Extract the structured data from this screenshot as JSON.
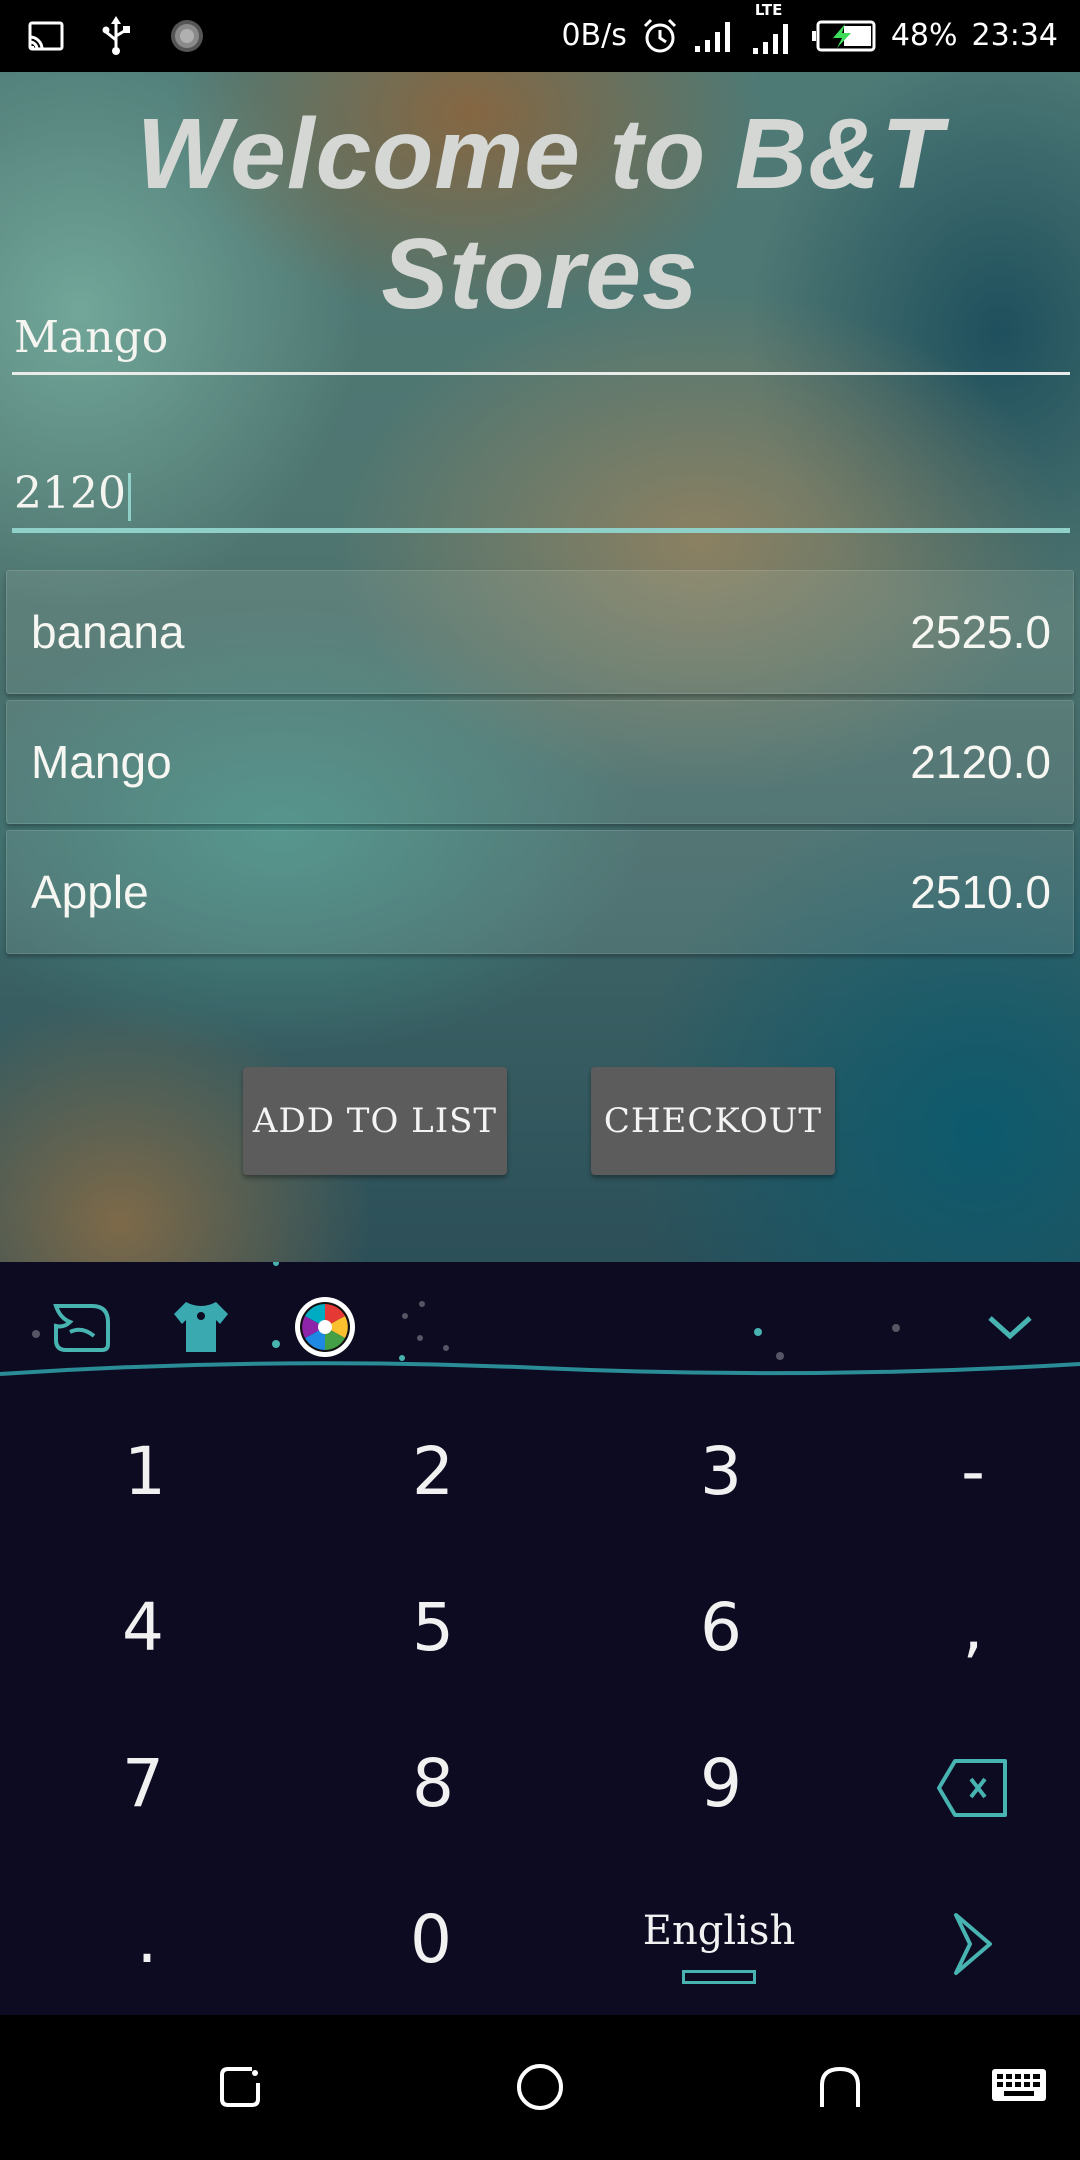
{
  "status_bar": {
    "net_speed": "0B/s",
    "network": "LTE",
    "battery": "48%",
    "time": "23:34"
  },
  "app": {
    "title": "Welcome to B&T Stores",
    "name_field_value": "Mango",
    "price_field_value": "2120",
    "items": [
      {
        "name": "banana",
        "price": "2525.0"
      },
      {
        "name": "Mango",
        "price": "2120.0"
      },
      {
        "name": "Apple",
        "price": "2510.0"
      }
    ],
    "add_button": "ADD TO LIST",
    "checkout_button": "CHECKOUT"
  },
  "keyboard": {
    "keys": [
      "1",
      "2",
      "3",
      "-",
      "4",
      "5",
      "6",
      ",",
      "7",
      "8",
      "9",
      ".",
      "0"
    ],
    "language": "English",
    "accent": "#48b4b2"
  }
}
